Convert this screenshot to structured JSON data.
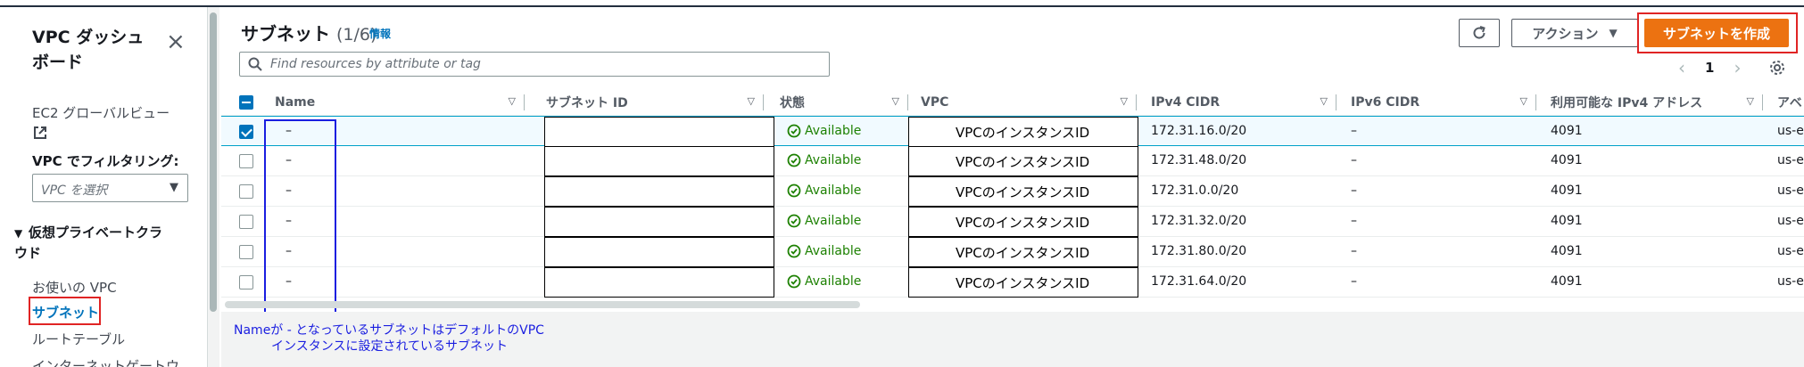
{
  "sidebar": {
    "title": "VPC ダッシュボード",
    "ec2_global_view": "EC2 グローバルビュー",
    "filter_label": "VPC でフィルタリング:",
    "filter_placeholder": "VPC を選択",
    "group_label": "仮想プライベートクラウド",
    "items": [
      "お使いの VPC",
      "サブネット",
      "ルートテーブル",
      "インターネットゲートウ"
    ]
  },
  "header": {
    "title": "サブネット",
    "count": "(1/6)",
    "info": "情報",
    "actions_label": "アクション",
    "create_label": "サブネットを作成",
    "search_placeholder": "Find resources by attribute or tag",
    "page_number": "1"
  },
  "table": {
    "columns": [
      "Name",
      "サブネット ID",
      "状態",
      "VPC",
      "IPv4 CIDR",
      "IPv6 CIDR",
      "利用可能な IPv4 アドレス",
      "アベ"
    ],
    "rows": [
      {
        "name": "–",
        "status": "Available",
        "vpc": "VPCのインスタンスID",
        "ipv4": "172.31.16.0/20",
        "ipv6": "–",
        "available": "4091",
        "az": "us-e",
        "selected": true
      },
      {
        "name": "–",
        "status": "Available",
        "vpc": "VPCのインスタンスID",
        "ipv4": "172.31.48.0/20",
        "ipv6": "–",
        "available": "4091",
        "az": "us-e",
        "selected": false
      },
      {
        "name": "–",
        "status": "Available",
        "vpc": "VPCのインスタンスID",
        "ipv4": "172.31.0.0/20",
        "ipv6": "–",
        "available": "4091",
        "az": "us-e",
        "selected": false
      },
      {
        "name": "–",
        "status": "Available",
        "vpc": "VPCのインスタンスID",
        "ipv4": "172.31.32.0/20",
        "ipv6": "–",
        "available": "4091",
        "az": "us-e",
        "selected": false
      },
      {
        "name": "–",
        "status": "Available",
        "vpc": "VPCのインスタンスID",
        "ipv4": "172.31.80.0/20",
        "ipv6": "–",
        "available": "4091",
        "az": "us-e",
        "selected": false
      },
      {
        "name": "–",
        "status": "Available",
        "vpc": "VPCのインスタンスID",
        "ipv4": "172.31.64.0/20",
        "ipv6": "–",
        "available": "4091",
        "az": "us-e",
        "selected": false
      }
    ]
  },
  "note": {
    "line1": "Nameが - となっているサブネットはデフォルトのVPC",
    "line2": "インスタンスに設定されているサブネット"
  },
  "colors": {
    "accent": "#ec7211",
    "link": "#0073bb",
    "available": "#1d8102",
    "annotation_red": "#e02424",
    "annotation_blue": "#1a1ee0"
  }
}
